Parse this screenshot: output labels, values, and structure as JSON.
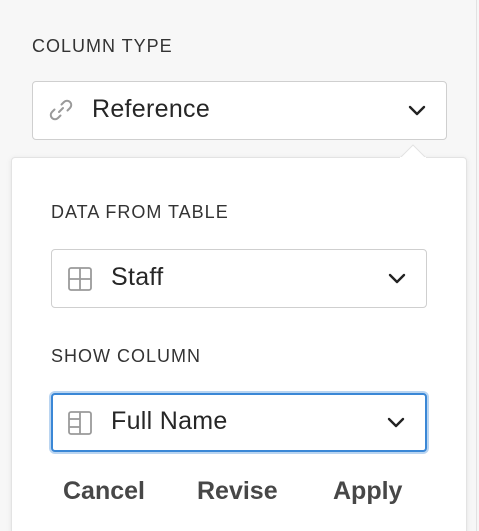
{
  "column_type": {
    "label": "COLUMN TYPE",
    "value": "Reference",
    "icon": "link-icon"
  },
  "popup": {
    "data_from_table": {
      "label": "DATA FROM TABLE",
      "value": "Staff",
      "icon": "table-grid-icon"
    },
    "show_column": {
      "label": "SHOW COLUMN",
      "value": "Full Name",
      "icon": "column-layout-icon"
    },
    "actions": {
      "cancel": "Cancel",
      "revise": "Revise",
      "apply": "Apply"
    }
  },
  "colors": {
    "focus": "#3a87d6",
    "text": "#262626",
    "label": "#333333",
    "background": "#f7f7f7"
  }
}
